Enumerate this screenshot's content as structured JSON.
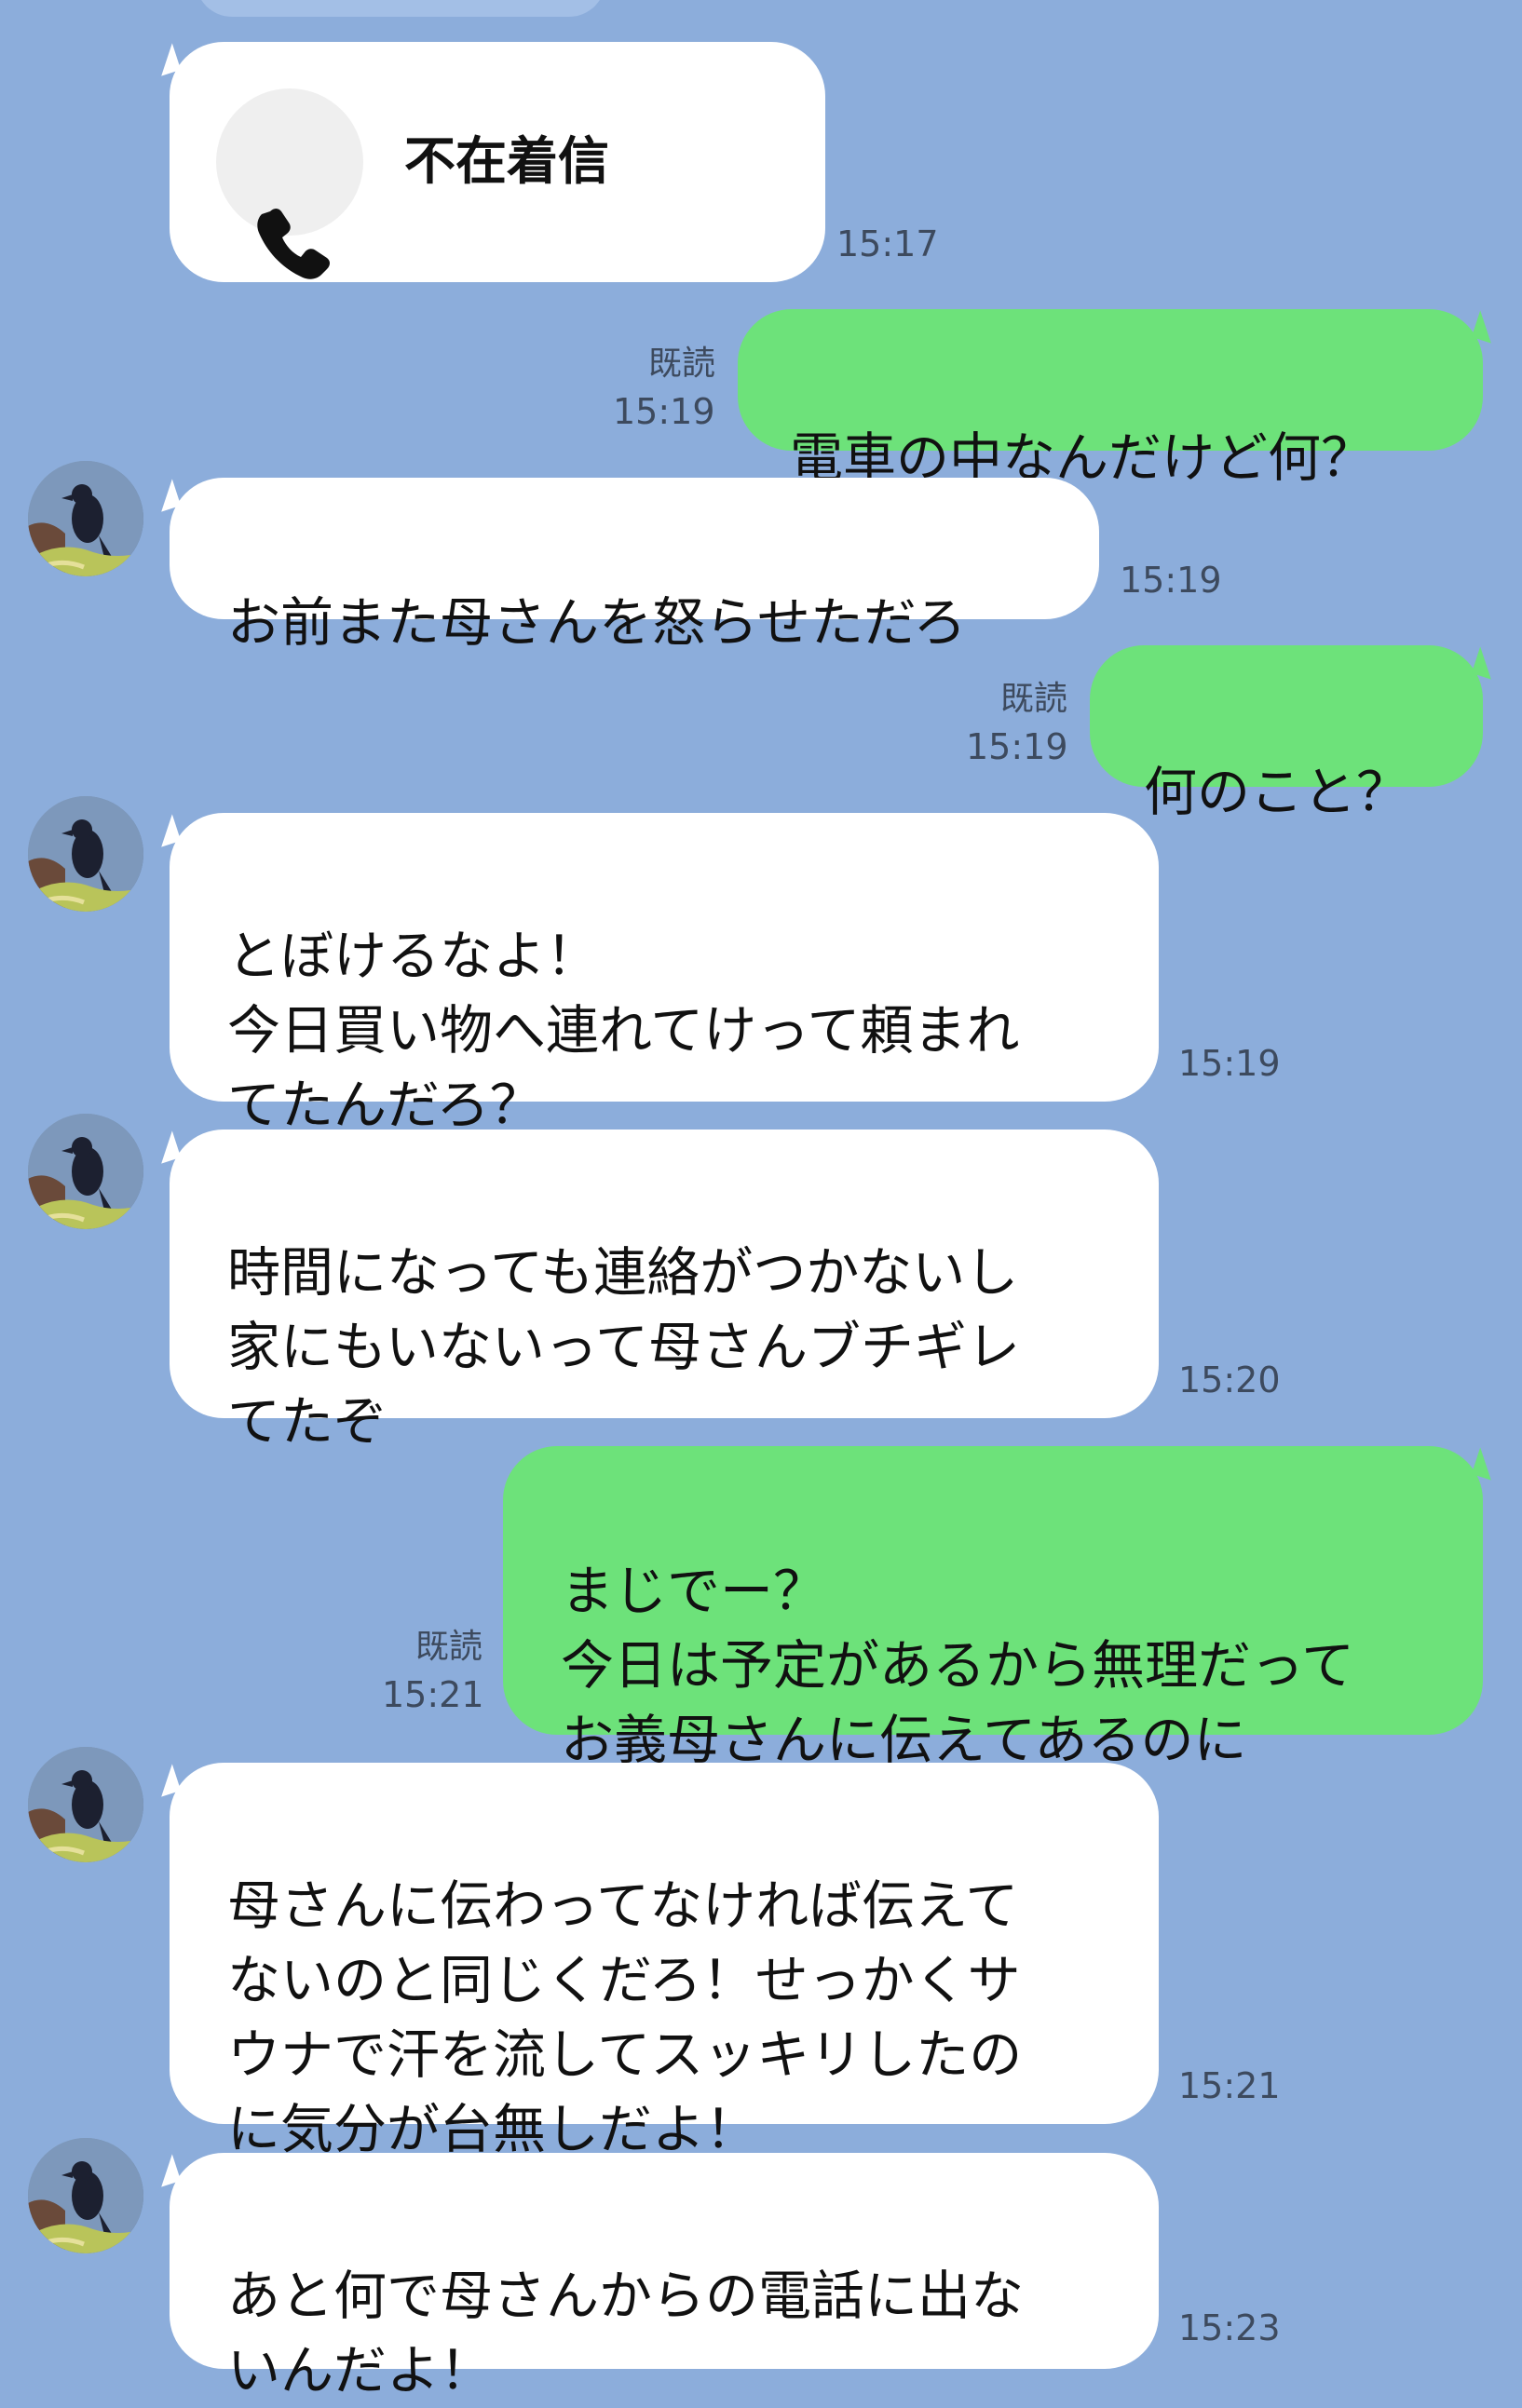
{
  "missed_call": {
    "label": "不在着信",
    "time": "15:17"
  },
  "messages": [
    {
      "direction": "out",
      "text": "電車の中なんだけど何？",
      "read": "既読",
      "time": "15:19"
    },
    {
      "direction": "in",
      "text": "お前また母さんを怒らせただろ",
      "time": "15:19"
    },
    {
      "direction": "out",
      "text": "何のこと？",
      "read": "既読",
      "time": "15:19"
    },
    {
      "direction": "in",
      "text": "とぼけるなよ！\n今日買い物へ連れてけって頼まれ\nてたんだろ？",
      "time": "15:19"
    },
    {
      "direction": "in",
      "text": "時間になっても連絡がつかないし\n家にもいないって母さんブチギレ\nてたぞ",
      "time": "15:20"
    },
    {
      "direction": "out",
      "text": "まじでー？\n今日は予定があるから無理だって\nお義母さんに伝えてあるのに",
      "read": "既読",
      "time": "15:21"
    },
    {
      "direction": "in",
      "text": "母さんに伝わってなければ伝えて\nないのと同じくだろ！せっかくサ\nウナで汗を流してスッキリしたの\nに気分が台無しだよ！",
      "time": "15:21"
    },
    {
      "direction": "in",
      "text": "あと何で母さんからの電話に出な\nいんだよ！",
      "time": "15:23"
    }
  ],
  "colors": {
    "background": "#8caddb",
    "incoming_bubble": "#ffffff",
    "outgoing_bubble": "#6de27a"
  },
  "icons": {
    "call": "phone-icon",
    "avatar": "crow-avatar"
  }
}
